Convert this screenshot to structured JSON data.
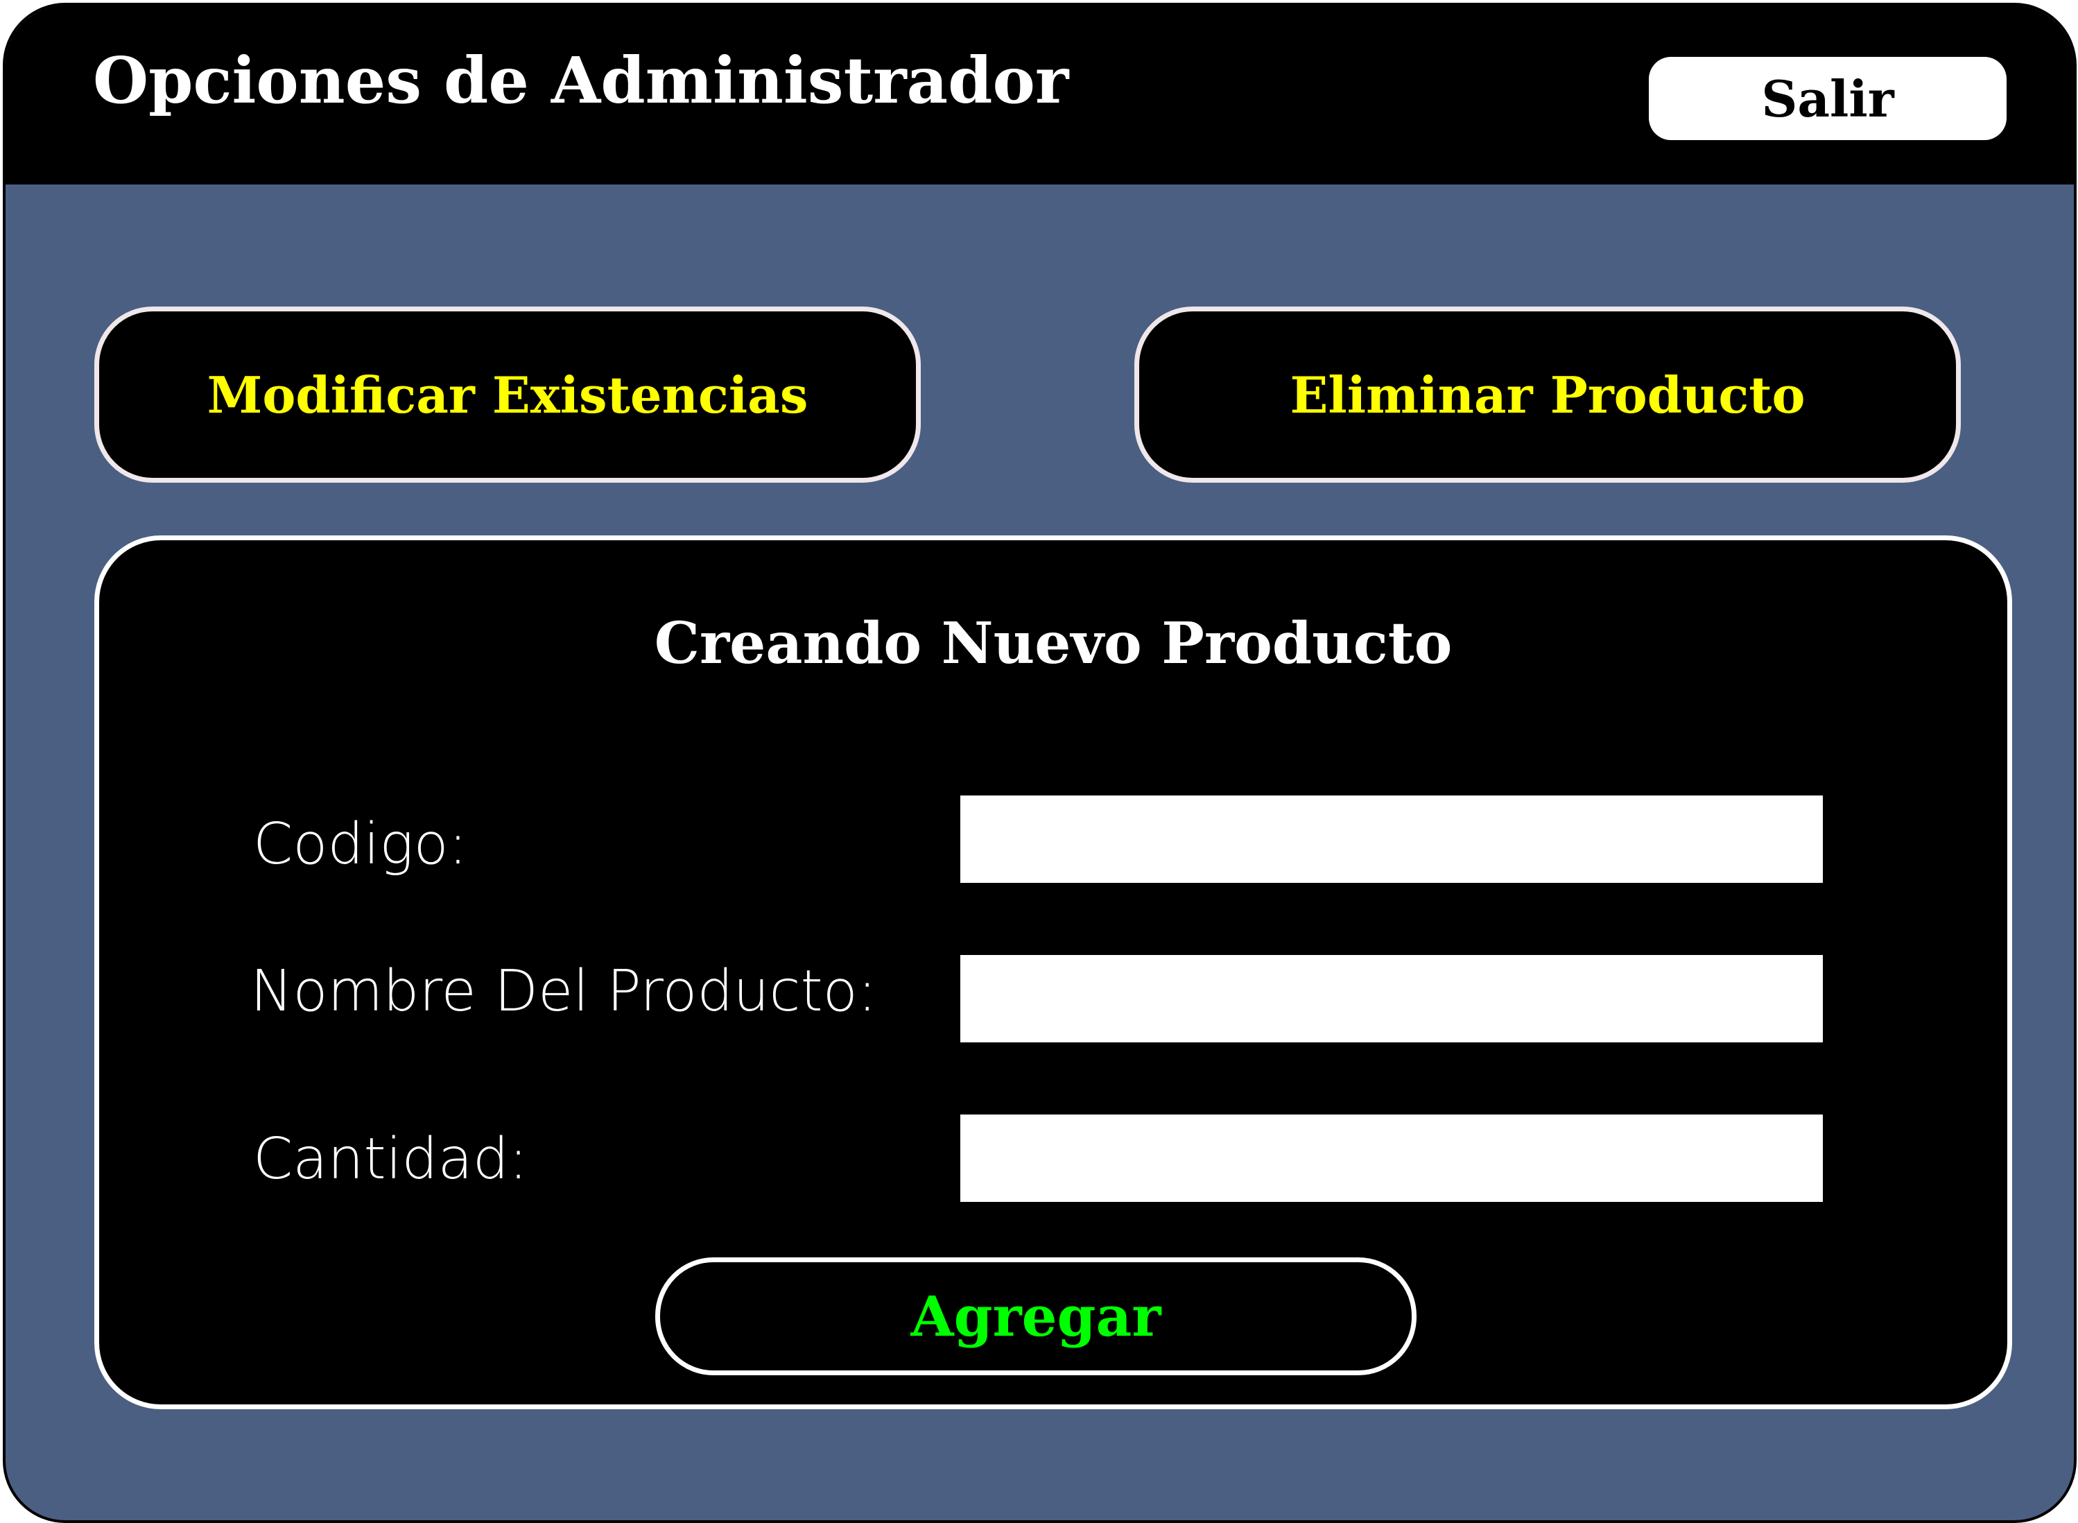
{
  "header": {
    "title": "Opciones de Administrador",
    "exit_label": "Salir"
  },
  "actions": {
    "modify_label": "Modificar Existencias",
    "delete_label": "Eliminar Producto"
  },
  "form": {
    "title": "Creando Nuevo Producto",
    "fields": [
      {
        "label": "Codigo:",
        "value": ""
      },
      {
        "label": "Nombre Del Producto:",
        "value": ""
      },
      {
        "label": "Cantidad:",
        "value": ""
      }
    ],
    "submit_label": "Agregar"
  },
  "colors": {
    "background": "#4b5f82",
    "header": "#000000",
    "action_text": "#ffff00",
    "submit_text": "#00ff00",
    "panel": "#000000",
    "input": "#ffffff"
  }
}
